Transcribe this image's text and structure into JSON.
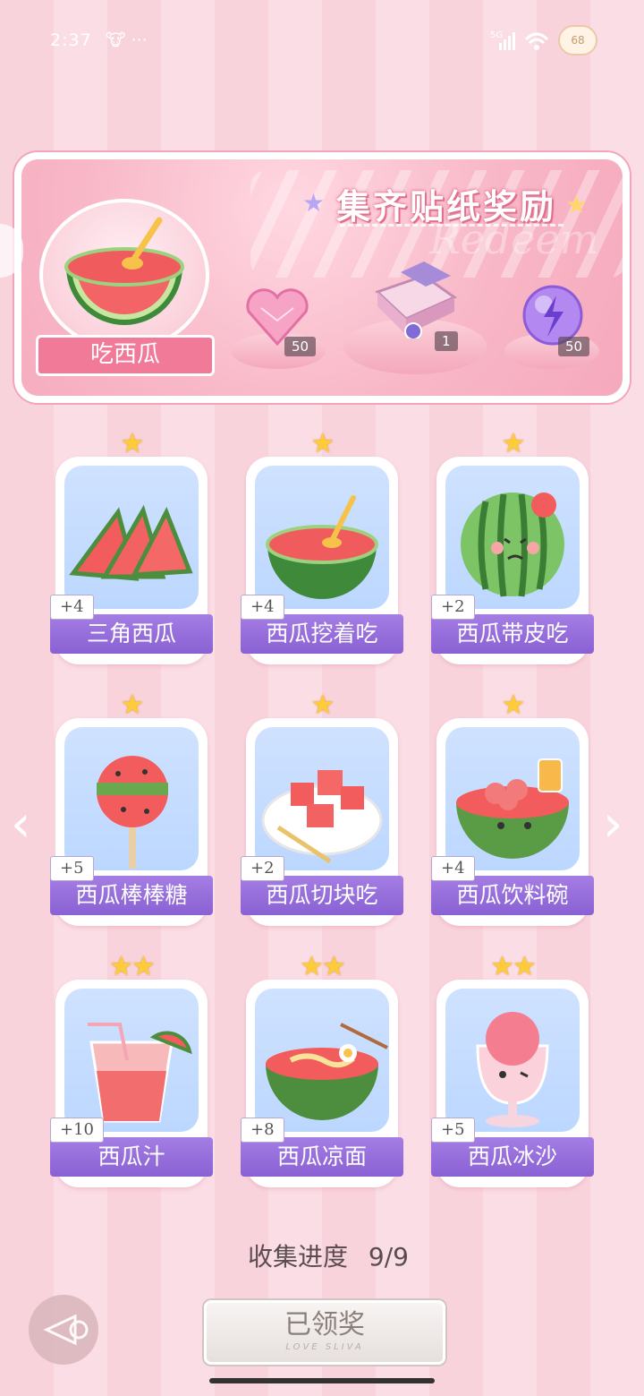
{
  "status_bar": {
    "time": "2:37",
    "extras": "🐮 ···",
    "network": "5G",
    "battery": "68"
  },
  "banner": {
    "title": "集齐贴纸奖励",
    "watermark": "Redeem",
    "main_item_label": "吃西瓜",
    "rewards": [
      {
        "name": "heart-gem",
        "count": "50"
      },
      {
        "name": "gift-box",
        "count": "1"
      },
      {
        "name": "purple-orb",
        "count": "50"
      }
    ]
  },
  "cards": [
    {
      "label": "三角西瓜",
      "points": "+4",
      "stars": "★"
    },
    {
      "label": "西瓜挖着吃",
      "points": "+4",
      "stars": "★"
    },
    {
      "label": "西瓜带皮吃",
      "points": "+2",
      "stars": "★"
    },
    {
      "label": "西瓜棒棒糖",
      "points": "+5",
      "stars": "★"
    },
    {
      "label": "西瓜切块吃",
      "points": "+2",
      "stars": "★"
    },
    {
      "label": "西瓜饮料碗",
      "points": "+4",
      "stars": "★"
    },
    {
      "label": "西瓜汁",
      "points": "+10",
      "stars": "★★"
    },
    {
      "label": "西瓜凉面",
      "points": "+8",
      "stars": "★★"
    },
    {
      "label": "西瓜冰沙",
      "points": "+5",
      "stars": "★★"
    }
  ],
  "progress": {
    "label": "收集进度",
    "value": "9/9"
  },
  "claim_button": {
    "label": "已领奖",
    "sub": "LOVE SLIVA"
  },
  "colors": {
    "label_purple": "#8a61d3",
    "banner_pink": "#f7b3c3",
    "star": "#ffcc39"
  }
}
